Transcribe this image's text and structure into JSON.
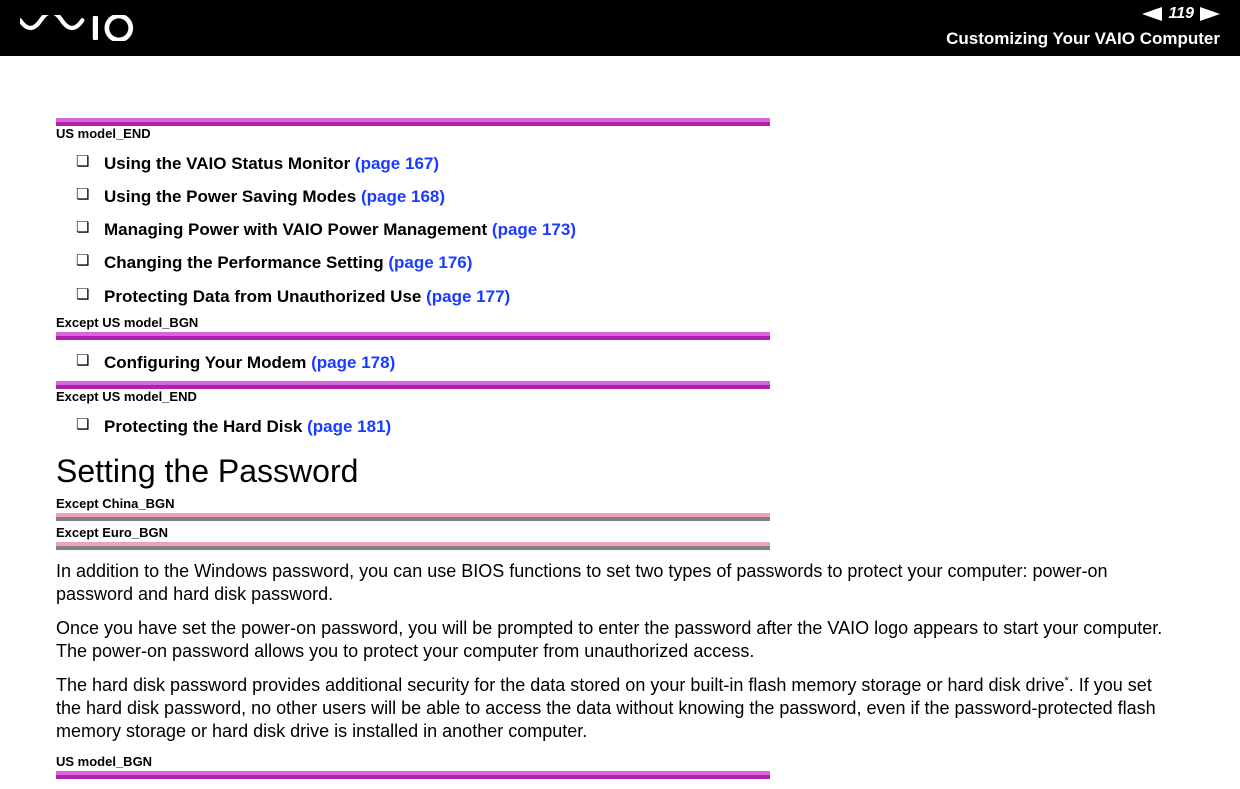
{
  "header": {
    "page_number": "119",
    "breadcrumb": "Customizing Your VAIO Computer"
  },
  "markers": {
    "us_model_end": "US model_END",
    "except_us_model_bgn": "Except US model_BGN",
    "except_us_model_end": "Except US model_END",
    "except_china_bgn": "Except China_BGN",
    "except_euro_bgn": "Except Euro_BGN",
    "us_model_bgn": "US model_BGN"
  },
  "links": {
    "group1": [
      {
        "text": "Using the VAIO Status Monitor ",
        "page": "(page 167)"
      },
      {
        "text": "Using the Power Saving Modes ",
        "page": "(page 168)"
      },
      {
        "text": "Managing Power with VAIO Power Management ",
        "page": "(page 173)"
      },
      {
        "text": "Changing the Performance Setting ",
        "page": "(page 176)"
      },
      {
        "text": "Protecting Data from Unauthorized Use ",
        "page": "(page 177)"
      }
    ],
    "group2": [
      {
        "text": "Configuring Your Modem ",
        "page": "(page 178)"
      }
    ],
    "group3": [
      {
        "text": "Protecting the Hard Disk ",
        "page": "(page 181)"
      }
    ]
  },
  "section": {
    "heading": "Setting the Password",
    "para1": "In addition to the Windows password, you can use BIOS functions to set two types of passwords to protect your computer: power-on password and hard disk password.",
    "para2": "Once you have set the power-on password, you will be prompted to enter the password after the VAIO logo appears to start your computer. The power-on password allows you to protect your computer from unauthorized access.",
    "para3_a": "The hard disk password provides additional security for the data stored on your built-in flash memory storage or hard disk drive",
    "para3_sup": "*",
    "para3_b": ". If you set the hard disk password, no other users will be able to access the data without knowing the password, even if the password-protected flash memory storage or hard disk drive is installed in another computer."
  }
}
